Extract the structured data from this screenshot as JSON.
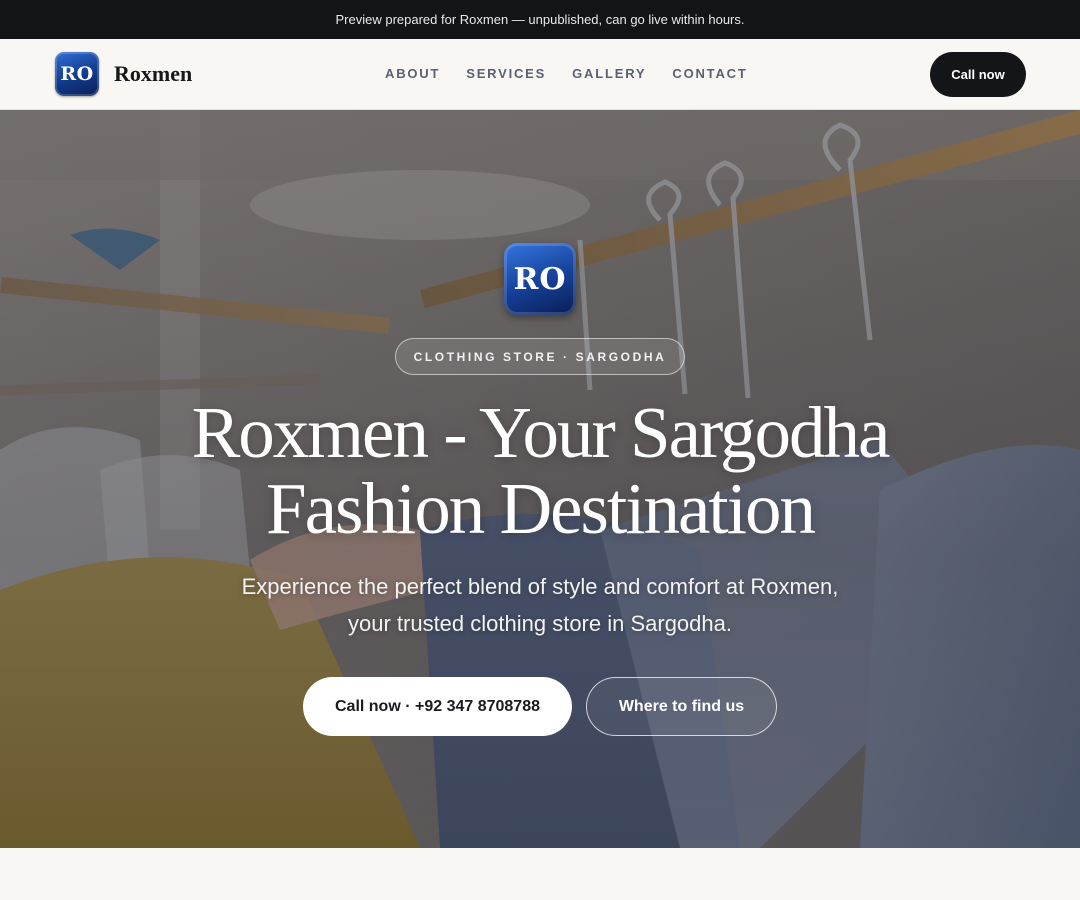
{
  "preview_bar": {
    "text": "Preview prepared for Roxmen — unpublished, can go live within hours."
  },
  "header": {
    "logo_text": "RO",
    "brand_name": "Roxmen",
    "nav": [
      {
        "label": "ABOUT"
      },
      {
        "label": "SERVICES"
      },
      {
        "label": "GALLERY"
      },
      {
        "label": "CONTACT"
      }
    ],
    "call_label": "Call now"
  },
  "hero": {
    "logo_text": "RO",
    "badge": "CLOTHING STORE · SARGODHA",
    "title_line1": "Roxmen - Your Sargodha",
    "title_line2": "Fashion Destination",
    "subtitle_line1": "Experience the perfect blend of style and comfort at Roxmen,",
    "subtitle_line2": "your trusted clothing store in Sargodha.",
    "primary_cta": "Call now · +92 347 8708788",
    "secondary_cta": "Where to find us"
  },
  "colors": {
    "preview_bar_bg": "#121418",
    "nav_bg": "#f8f7f4",
    "dark_button": "#141519",
    "logo_blue": "#143f96"
  },
  "icons": {
    "brand_logo": "ro-logo-badge",
    "hero_image": "clothing-rack-photo"
  }
}
